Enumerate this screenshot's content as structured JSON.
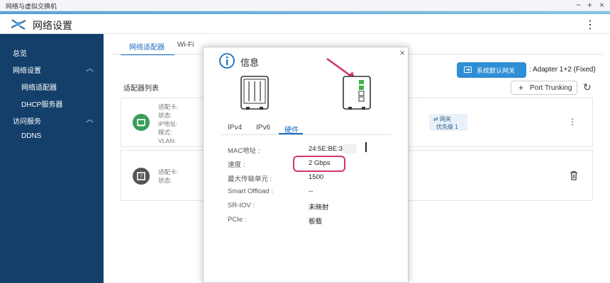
{
  "window": {
    "title": "网络与虚拟交换机"
  },
  "app": {
    "title": "网络设置"
  },
  "sidebar": {
    "items": [
      {
        "label": "总览"
      },
      {
        "label": "网络设置"
      },
      {
        "label": "网络适配器"
      },
      {
        "label": "DHCP服务器"
      },
      {
        "label": "访问服务"
      },
      {
        "label": "DDNS"
      }
    ]
  },
  "main": {
    "tabs": [
      {
        "label": "网络适配器"
      },
      {
        "label": "Wi-Fi"
      }
    ],
    "gateway_button": "系统默认网关",
    "gateway_value": ": Adapter 1+2 (Fixed)",
    "section_label": "适配器列表",
    "trunk_button": "Port Trunking",
    "card1": {
      "labels": [
        "适配卡:",
        "状态:",
        "IP地址:",
        "模式:",
        "VLAN:"
      ],
      "gateway_tag": "网关",
      "priority": "优先级 1"
    },
    "card2": {
      "labels": [
        "适配卡:",
        "状态:"
      ]
    }
  },
  "modal": {
    "title": "信息",
    "tabs": [
      {
        "label": "IPv4"
      },
      {
        "label": "IPv6"
      },
      {
        "label": "硬件"
      }
    ],
    "rows": [
      {
        "label": "MAC地址 :",
        "value": "24:5E:BE:33"
      },
      {
        "label": "速度 :",
        "value": "2 Gbps"
      },
      {
        "label": "最大传输单元 :",
        "value": "1500"
      },
      {
        "label": "Smart Offload :",
        "value": "--"
      },
      {
        "label": "SR-IOV :",
        "value": "未映射"
      },
      {
        "label": "PCIe :",
        "value": "板载"
      }
    ]
  },
  "colors": {
    "sidebar": "#143f6b",
    "accent": "#1b6ec2",
    "button": "#2f8ed5",
    "highlight": "#d6336c",
    "status_green": "#3a9c5b"
  }
}
